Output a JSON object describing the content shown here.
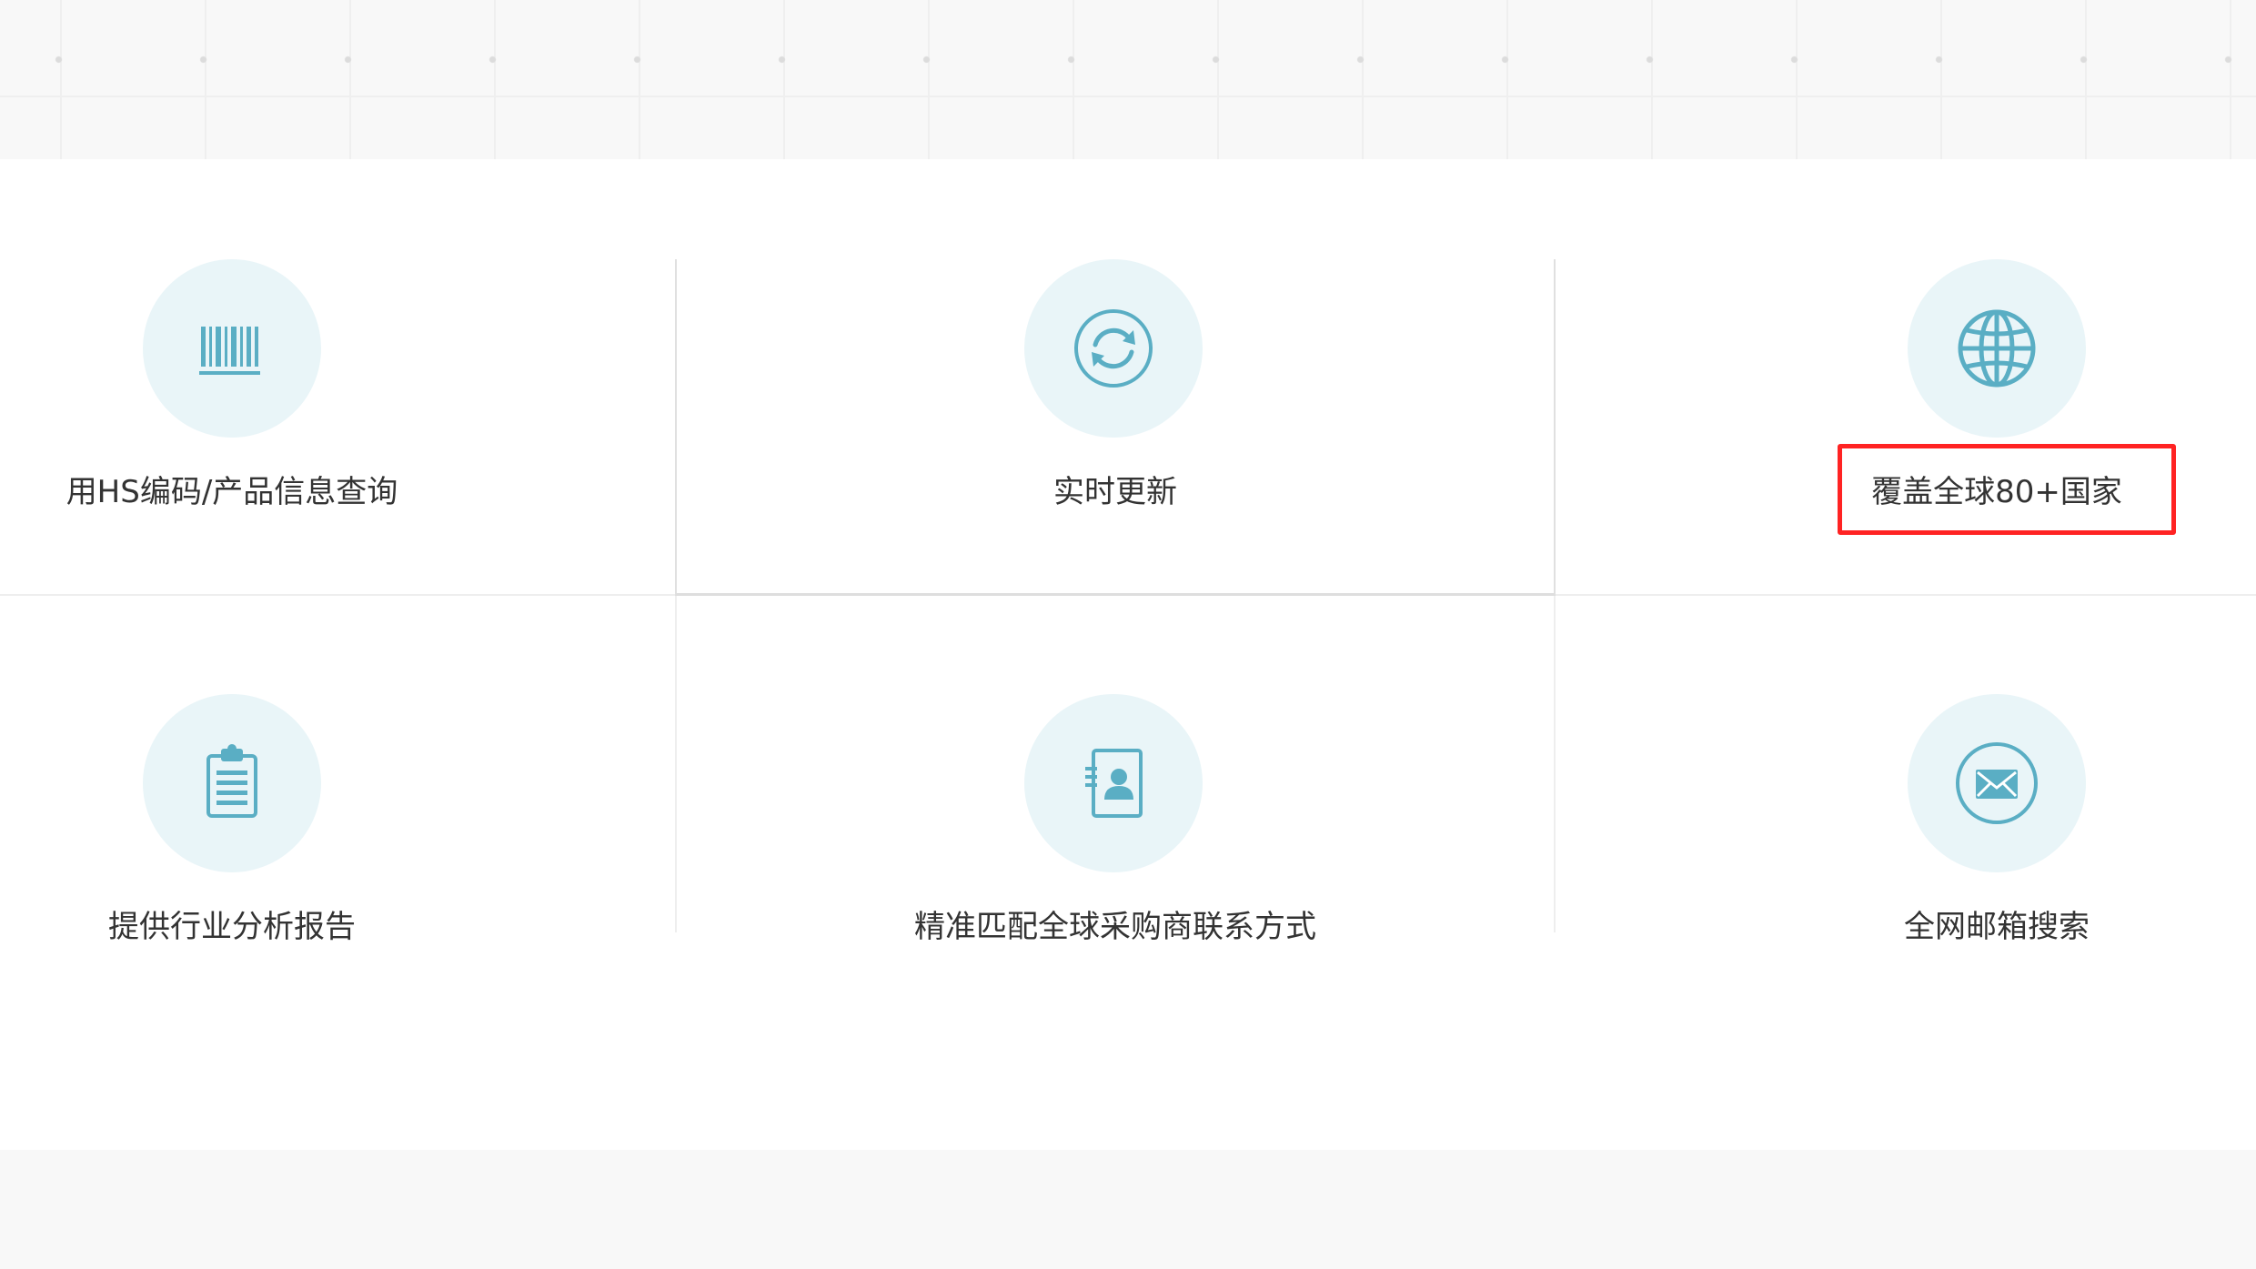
{
  "features": [
    {
      "label": "用HS编码/产品信息查询",
      "icon": "barcode-icon"
    },
    {
      "label": "实时更新",
      "icon": "refresh-icon"
    },
    {
      "label": "覆盖全球80+国家",
      "icon": "globe-icon"
    },
    {
      "label": "提供行业分析报告",
      "icon": "clipboard-report-icon"
    },
    {
      "label": "精准匹配全球采购商联系方式",
      "icon": "contact-book-icon"
    },
    {
      "label": "全网邮箱搜索",
      "icon": "envelope-icon"
    }
  ],
  "colors": {
    "icon_teal": "#5aaec4",
    "icon_circle_bg": "#e9f5f8",
    "label_text": "#333333",
    "highlight_border": "#ff2323",
    "band_bg": "#f8f8f8"
  }
}
